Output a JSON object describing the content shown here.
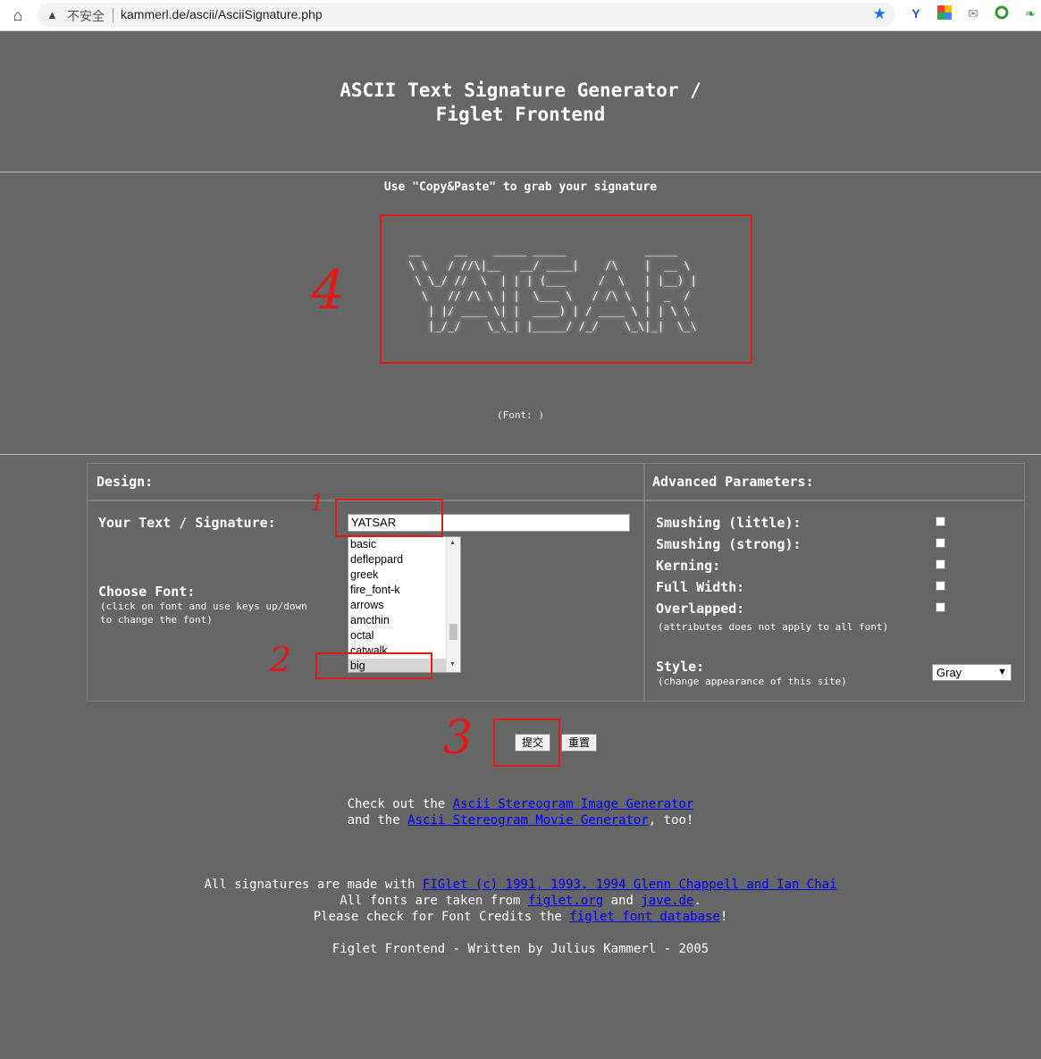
{
  "browser": {
    "security_label": "不安全",
    "url": "kammerl.de/ascii/AsciiSignature.php"
  },
  "page": {
    "title_line1": "ASCII Text Signature Generator /",
    "title_line2": "Figlet Frontend",
    "copy_hint": "Use \"Copy&Paste\" to grab your signature",
    "ascii_signature": "__     __    _____ _____            _____  \n\\ \\   / //\\|__   __/ ____|    /\\    |  __ \\ \n \\ \\_/ //  \\  | | | (___     /  \\   | |__) |\n  \\   // /\\ \\ | |  \\___ \\   / /\\ \\  |  _  / \n   | |/ ____ \\| |  ____) | / ____ \\ | | \\ \\ \n   |_/_/    \\_\\_| |_____/ /_/    \\_\\|_|  \\_\\",
    "font_note": "(Font: )"
  },
  "form": {
    "design_header": "Design:",
    "advanced_header": "Advanced Parameters:",
    "text_label": "Your Text / Signature:",
    "text_value": "YATSAR",
    "font_label": "Choose Font:",
    "font_hint_line1": "(click on font and use keys up/down",
    "font_hint_line2": "to change the font)",
    "fonts": [
      "basic",
      "defleppard",
      "greek",
      "fire_font-k",
      "arrows",
      "amcthin",
      "octal",
      "catwalk",
      "big"
    ],
    "selected_font": "big",
    "smushing_little": "Smushing (little):",
    "smushing_strong": "Smushing (strong):",
    "kerning": "Kerning:",
    "full_width": "Full Width:",
    "overlapped": "Overlapped:",
    "attr_note": "(attributes does not apply to all font)",
    "style_label": "Style:",
    "style_hint": "(change appearance of this site)",
    "style_value": "Gray",
    "submit_label": "提交",
    "reset_label": "重置"
  },
  "footer": {
    "check_prefix": "Check out the ",
    "stereogram_image_link": "Ascii Stereogram Image Generator",
    "and_the": "and the ",
    "stereogram_movie_link": "Ascii Stereogram Movie Generator",
    "too": ", too!",
    "made_with": "All signatures are made with ",
    "figlet_link": "FIGlet (c) 1991, 1993, 1994 Glenn Chappell and Ian Chai",
    "fonts_from": "All fonts are taken from ",
    "figlet_org_link": "figlet.org",
    "and_word": " and ",
    "jave_link": "jave.de",
    "period": ".",
    "please_check": "Please check for Font Credits the ",
    "font_db_link": "figlet font database",
    "excl": "!",
    "written_by": "Figlet Frontend - Written by Julius Kammerl - 2005"
  },
  "annotations": [
    "1",
    "2",
    "3",
    "4"
  ]
}
